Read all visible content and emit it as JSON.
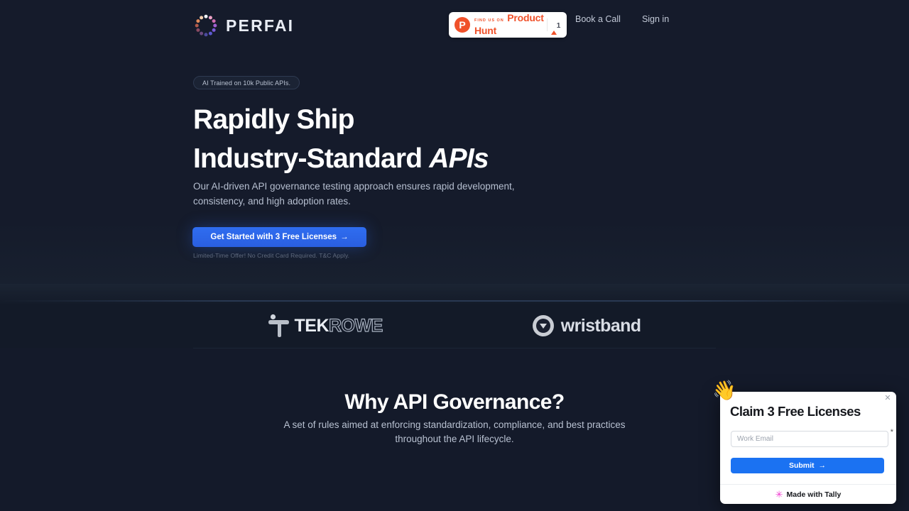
{
  "brand": {
    "logo_text": "PERFAI",
    "logo_icon": "dotted-ring-icon"
  },
  "header": {
    "product_hunt": {
      "eyebrow": "FIND US ON",
      "name": "Product Hunt",
      "icon": "P",
      "upvote_icon": "triangle-up-icon",
      "count": "1"
    },
    "nav": [
      {
        "label": "Book a Call",
        "name": "nav-book-a-call"
      },
      {
        "label": "Sign in",
        "name": "nav-sign-in"
      }
    ]
  },
  "hero": {
    "badge": "AI Trained on 10k Public APIs.",
    "headline_line1": "Rapidly Ship",
    "headline_line2_plain": "Industry-Standard ",
    "headline_line2_italic": "APIs",
    "subtitle": "Our AI-driven API governance testing approach ensures rapid development, consistency, and high adoption rates.",
    "cta_label": "Get Started with 3 Free Licenses",
    "cta_arrow": "→",
    "fineprint": "Limited-Time Offer! No Credit Card Required. T&C Apply."
  },
  "clients": [
    {
      "name": "tekrowe-logo",
      "bold": "TEK",
      "outline": "ROWE"
    },
    {
      "name": "wristband-logo",
      "word": "wristband",
      "icon": "triangle-down-circle-icon"
    }
  ],
  "why_section": {
    "title": "Why API Governance?",
    "description": "A set of rules aimed at enforcing standardization, compliance, and best practices throughout the API lifecycle."
  },
  "popup": {
    "hand_emoji": "👋",
    "close_label": "✕",
    "title": "Claim 3 Free Licenses",
    "email_placeholder": "Work Email",
    "email_value": "",
    "required_marker": "*",
    "submit_label": "Submit",
    "submit_arrow": "→",
    "footer_star": "✳",
    "footer_text": "Made with Tally"
  },
  "colors": {
    "background": "#141a2a",
    "accent_blue": "#2f6df0",
    "product_hunt_orange": "#f0512a",
    "tally_pink": "#f03ad0"
  }
}
